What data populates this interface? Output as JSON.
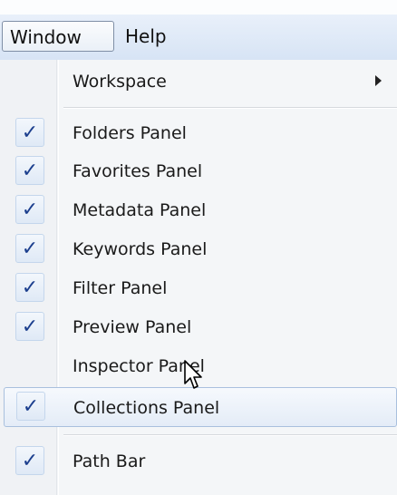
{
  "menubar": {
    "items": [
      "Window",
      "Help"
    ]
  },
  "menu": {
    "items": [
      {
        "label": "Workspace",
        "checked": false,
        "submenu": true
      },
      {
        "label": "Folders Panel",
        "checked": true
      },
      {
        "label": "Favorites Panel",
        "checked": true
      },
      {
        "label": "Metadata Panel",
        "checked": true
      },
      {
        "label": "Keywords Panel",
        "checked": true
      },
      {
        "label": "Filter Panel",
        "checked": true
      },
      {
        "label": "Preview Panel",
        "checked": true
      },
      {
        "label": "Inspector Panel",
        "checked": false
      },
      {
        "label": "Collections Panel",
        "checked": true,
        "hovered": true
      },
      {
        "label": "Path Bar",
        "checked": true
      }
    ],
    "check_glyph": "✓"
  },
  "colors": {
    "accent": "#1c3f8e",
    "menubar": "#d7e4f5",
    "hover_border": "#a9c0de"
  },
  "icons": {
    "cursor": "mouse-pointer-icon",
    "submenu": "submenu-arrow-icon",
    "check": "checkmark-icon"
  }
}
